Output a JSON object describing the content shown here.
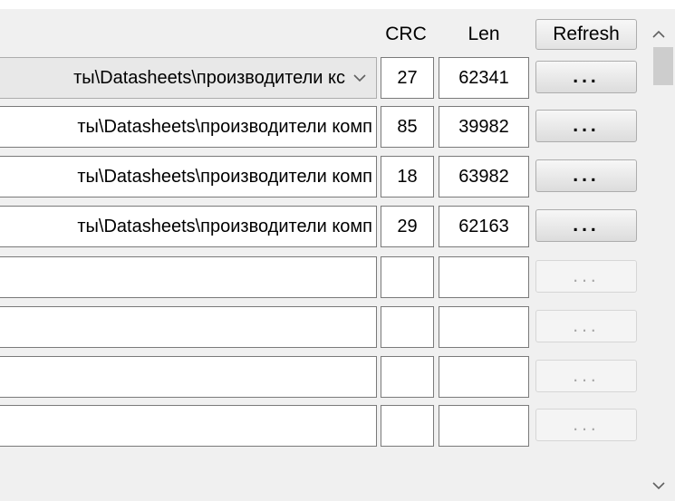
{
  "header": {
    "crc_label": "CRC",
    "len_label": "Len",
    "refresh_label": "Refresh"
  },
  "rows": [
    {
      "path": "ты\\Datasheets\\производители кс",
      "crc": "27",
      "len": "62341",
      "browse_label": "...",
      "enabled": true
    },
    {
      "path": "ты\\Datasheets\\производители комп",
      "crc": "85",
      "len": "39982",
      "browse_label": "...",
      "enabled": true
    },
    {
      "path": "ты\\Datasheets\\производители комп",
      "crc": "18",
      "len": "63982",
      "browse_label": "...",
      "enabled": true
    },
    {
      "path": "ты\\Datasheets\\производители комп",
      "crc": "29",
      "len": "62163",
      "browse_label": "...",
      "enabled": true
    },
    {
      "path": "",
      "crc": "",
      "len": "",
      "browse_label": "...",
      "enabled": false
    },
    {
      "path": "",
      "crc": "",
      "len": "",
      "browse_label": "...",
      "enabled": false
    },
    {
      "path": "",
      "crc": "",
      "len": "",
      "browse_label": "...",
      "enabled": false
    },
    {
      "path": "",
      "crc": "",
      "len": "",
      "browse_label": "...",
      "enabled": false
    }
  ],
  "icons": {
    "dropdown": "chevron-down-icon",
    "scroll_up": "scroll-up-arrow-icon",
    "scroll_down": "scroll-down-arrow-icon"
  }
}
